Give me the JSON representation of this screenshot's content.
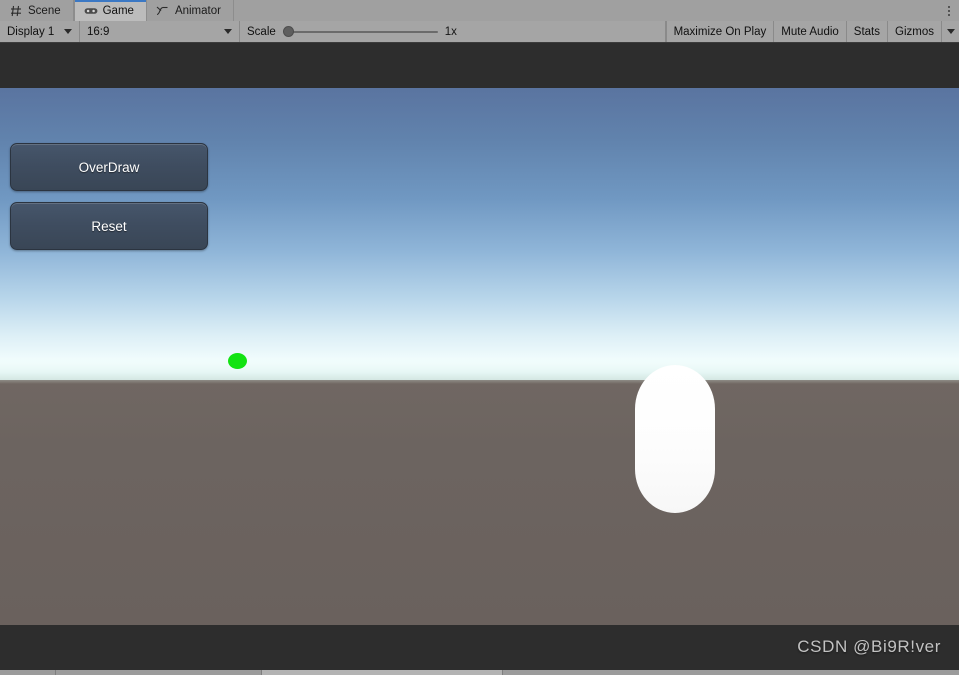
{
  "window": {
    "tabs": [
      {
        "label": "Scene",
        "icon": "grid-icon",
        "active": false
      },
      {
        "label": "Game",
        "icon": "gamepad-icon",
        "active": true
      },
      {
        "label": "Animator",
        "icon": "animation-curve-icon",
        "active": false
      }
    ],
    "menu_icon": "kebab-menu-icon"
  },
  "toolbar": {
    "display": {
      "label": "Display 1",
      "icon": "chevron-down-icon"
    },
    "aspect": {
      "label": "16:9",
      "icon": "chevron-down-icon"
    },
    "scale": {
      "label": "Scale",
      "value": "1x",
      "slider_position_percent": 0
    },
    "maximize_on_play": "Maximize On Play",
    "mute_audio": "Mute Audio",
    "stats": "Stats",
    "gizmos": "Gizmos",
    "gizmos_caret_icon": "chevron-down-icon"
  },
  "game": {
    "buttons": [
      {
        "label": "OverDraw",
        "name": "overdraw-button"
      },
      {
        "label": "Reset",
        "name": "reset-button"
      }
    ],
    "objects": [
      {
        "name": "green-marker",
        "kind": "ellipse",
        "color": "#12e312"
      },
      {
        "name": "white-capsule",
        "kind": "capsule",
        "color": "#ffffff"
      }
    ],
    "sky": {
      "top_color": "#5a74a0",
      "horizon_color": "#ffffff",
      "haze_color": "#e6f7f5"
    },
    "ground": {
      "color": "#6c6460"
    },
    "letterbox_color": "#2d2d2d"
  },
  "watermark": {
    "text": "CSDN @Bi9R!ver"
  },
  "colors": {
    "tabbar_bg": "#a0a0a0",
    "tab_active_bg": "#bcbcbc",
    "tab_accent": "#3b78c4",
    "toolbar_bg": "#a5a5a5",
    "statusbar_bg": "#9b9b9b"
  }
}
